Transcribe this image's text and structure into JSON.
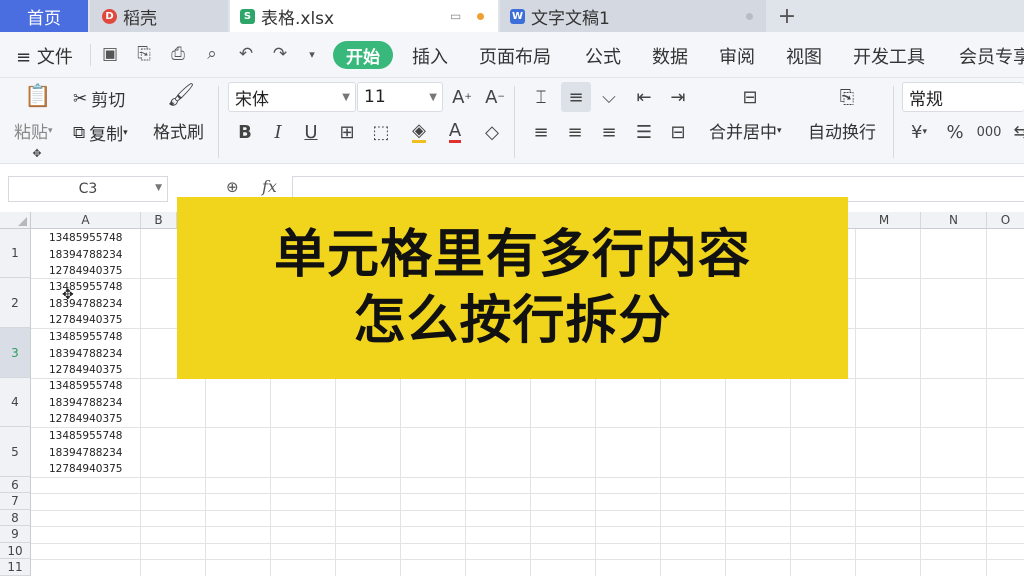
{
  "tabs": [
    {
      "label": "首页"
    },
    {
      "label": "稻壳"
    },
    {
      "label": "表格.xlsx"
    },
    {
      "label": "文字文稿1"
    }
  ],
  "menu": {
    "file": "文件",
    "items": [
      "开始",
      "插入",
      "页面布局",
      "公式",
      "数据",
      "审阅",
      "视图",
      "开发工具",
      "会员专享"
    ]
  },
  "ribbon": {
    "paste": "粘贴",
    "cut": "剪切",
    "copy": "复制",
    "format_painter": "格式刷",
    "font_name": "宋体",
    "font_size": "11",
    "merge_center": "合并居中",
    "wrap_text": "自动换行",
    "number_format": "常规"
  },
  "formula_bar": {
    "cell_ref": "C3",
    "fx": "fx"
  },
  "columns": [
    "A",
    "B",
    "M",
    "N",
    "O"
  ],
  "rows": [
    "1",
    "2",
    "3",
    "4",
    "5",
    "6",
    "7",
    "8",
    "9",
    "10",
    "11"
  ],
  "cells": {
    "A1": [
      "13485955748",
      "18394788234",
      "12784940375"
    ],
    "A2": [
      "13485955748",
      "18394788234",
      "12784940375"
    ],
    "A3": [
      "13485955748",
      "18394788234",
      "12784940375"
    ],
    "A4": [
      "13485955748",
      "18394788234",
      "12784940375"
    ],
    "A5": [
      "13485955748",
      "18394788234",
      "12784940375"
    ]
  },
  "overlay": {
    "line1": "单元格里有多行内容",
    "line2": "怎么按行拆分"
  },
  "colors": {
    "home_tab": "#4a6ee0",
    "start_button": "#38b87a",
    "overlay_bg": "#f1d51d"
  }
}
